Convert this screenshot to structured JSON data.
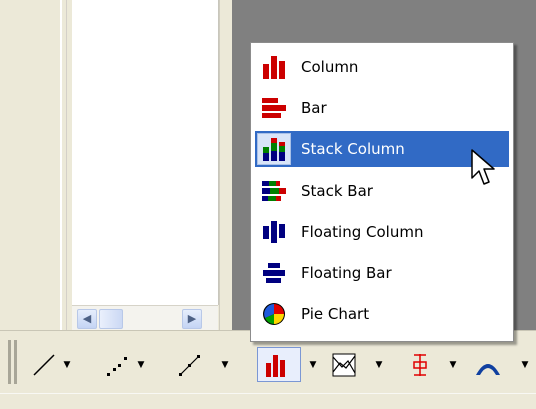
{
  "menu": {
    "items": [
      {
        "label": "Column",
        "icon": "column-chart-icon"
      },
      {
        "label": "Bar",
        "icon": "bar-chart-icon"
      },
      {
        "label": "Stack Column",
        "icon": "stack-column-chart-icon",
        "highlighted": true
      },
      {
        "label": "Stack Bar",
        "icon": "stack-bar-chart-icon"
      },
      {
        "label": "Floating Column",
        "icon": "floating-column-chart-icon"
      },
      {
        "label": "Floating Bar",
        "icon": "floating-bar-chart-icon"
      },
      {
        "label": "Pie Chart",
        "icon": "pie-chart-icon"
      }
    ]
  },
  "toolbar": {
    "tools": [
      "line-icon",
      "scatter-icon",
      "line-scatter-icon",
      "bar-chart-icon",
      "area-chart-icon",
      "error-bar-icon",
      "curve-icon"
    ]
  },
  "colors": {
    "highlight": "#316ac5",
    "chart_red": "#cc0000",
    "chart_blue": "#000080",
    "chart_green": "#008000"
  }
}
